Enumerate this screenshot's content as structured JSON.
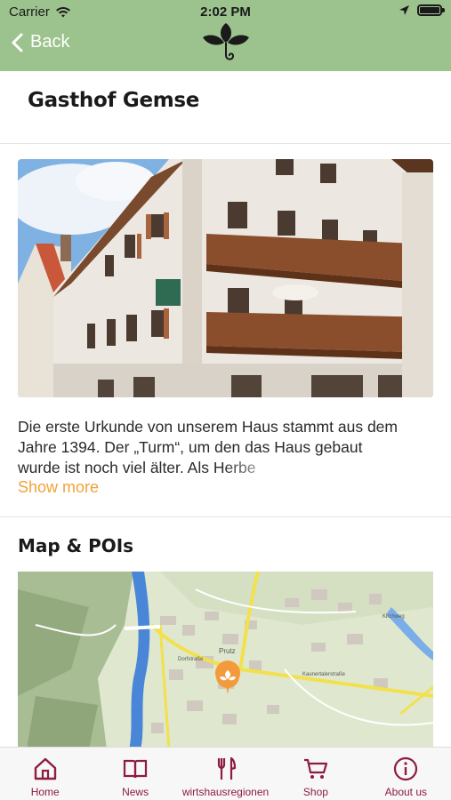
{
  "status_bar": {
    "carrier": "Carrier",
    "time": "2:02 PM"
  },
  "nav": {
    "back_label": "Back"
  },
  "page": {
    "title": "Gasthof Gemse",
    "description_lines": [
      "Die erste Urkunde von unserem Haus stammt aus dem",
      "Jahre 1394. Der „Turm“, um den das Haus gebaut",
      "wurde ist noch viel älter. Als Herbe"
    ],
    "show_more": "Show more",
    "map_section_title": "Map & POIs"
  },
  "map": {
    "labels": [
      "Prutz",
      "Kaunertalerstraße",
      "Dorfstraße",
      "Kirchweg"
    ]
  },
  "tabs": [
    {
      "label": "Home",
      "icon": "home-icon"
    },
    {
      "label": "News",
      "icon": "book-icon"
    },
    {
      "label": "wirtshausregionen",
      "icon": "fork-knife-icon"
    },
    {
      "label": "Shop",
      "icon": "cart-icon"
    },
    {
      "label": "About us",
      "icon": "info-icon"
    }
  ],
  "colors": {
    "header": "#9cc38e",
    "accent": "#8e1c3f",
    "link": "#f2a23a"
  }
}
